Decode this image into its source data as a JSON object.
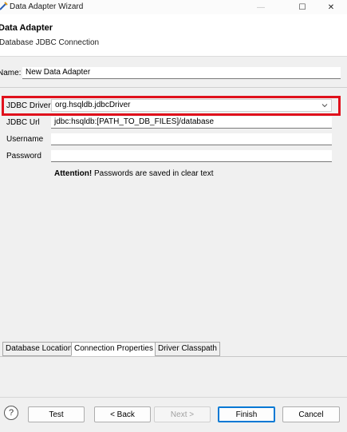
{
  "window": {
    "title": "Data Adapter Wizard",
    "controls": {
      "minimize": "—",
      "maximize": "☐",
      "close": "✕"
    }
  },
  "header": {
    "title": "Data Adapter",
    "subtitle": "Database JDBC Connection"
  },
  "name_field": {
    "label": "Name:",
    "value": "New Data Adapter"
  },
  "connection": {
    "jdbc_driver": {
      "label": "JDBC Driver",
      "value": "org.hsqldb.jdbcDriver"
    },
    "jdbc_url": {
      "label": "JDBC Url",
      "value": "jdbc:hsqldb:[PATH_TO_DB_FILES]/database"
    },
    "username": {
      "label": "Username",
      "value": ""
    },
    "password": {
      "label": "Password",
      "value": ""
    }
  },
  "attention": {
    "bold": "Attention!",
    "text": " Passwords are saved in clear text"
  },
  "tabs": [
    {
      "label": "Database Location",
      "selected": false
    },
    {
      "label": "Connection Properties",
      "selected": true
    },
    {
      "label": "Driver Classpath",
      "selected": false
    }
  ],
  "footer": {
    "help": "?",
    "test": "Test",
    "back": "< Back",
    "next": "Next >",
    "finish": "Finish",
    "cancel": "Cancel"
  },
  "colors": {
    "highlight": "#e0111c",
    "default_button_border": "#0078d4"
  }
}
